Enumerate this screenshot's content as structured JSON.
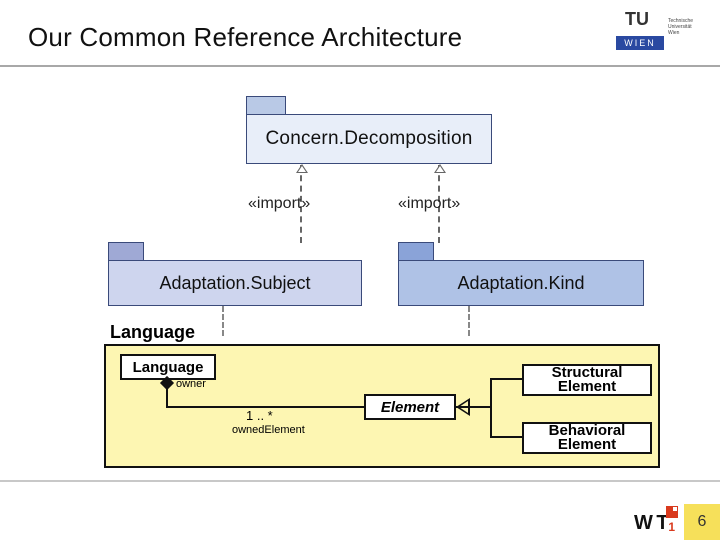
{
  "header": {
    "title": "Our Common Reference Architecture",
    "institution_logo": {
      "top": "TU",
      "bottom": "WIEN",
      "side_text": "Technische Universität Wien"
    }
  },
  "packages": {
    "top": {
      "name": "Concern.Decomposition"
    },
    "left": {
      "name": "Adaptation.Subject"
    },
    "right": {
      "name": "Adaptation.Kind"
    }
  },
  "dependencies": {
    "stereotype": "«import»"
  },
  "language_metamodel": {
    "title": "Language",
    "classes": {
      "language": "Language",
      "element": "Element",
      "structural": "Structural Element",
      "behavioral": "Behavioral Element"
    },
    "assoc": {
      "owner_role": "owner",
      "owned_role": "ownedElement",
      "multiplicity": "1 .. *"
    }
  },
  "footer": {
    "page_number": "6",
    "group_logo": {
      "text": "W T",
      "accent": "1"
    }
  }
}
